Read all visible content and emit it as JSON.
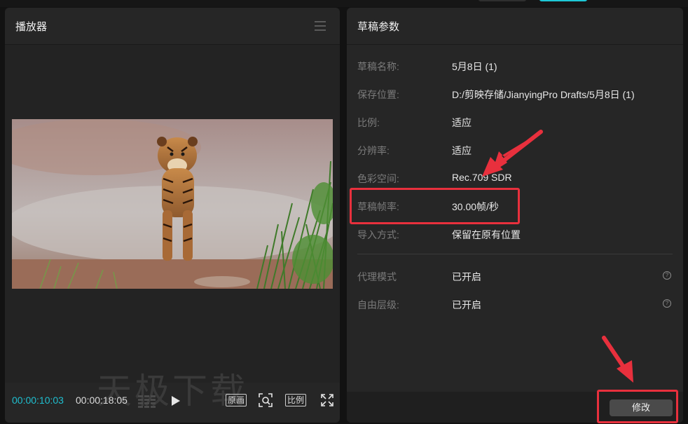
{
  "player": {
    "title": "播放器",
    "watermark": "天极下载",
    "time_current": "00:00:10:03",
    "time_total": "00:00:18:05",
    "btn_original": "原画",
    "btn_ratio": "比例"
  },
  "draft": {
    "title": "草稿参数",
    "rows": [
      {
        "label": "草稿名称:",
        "value": "5月8日 (1)"
      },
      {
        "label": "保存位置:",
        "value": "D:/剪映存储/JianyingPro Drafts/5月8日 (1)"
      },
      {
        "label": "比例:",
        "value": "适应"
      },
      {
        "label": "分辨率:",
        "value": "适应"
      },
      {
        "label": "色彩空间:",
        "value": "Rec.709 SDR"
      },
      {
        "label": "草稿帧率:",
        "value": "30.00帧/秒"
      },
      {
        "label": "导入方式:",
        "value": "保留在原有位置"
      },
      {
        "label": "代理模式",
        "value": "已开启"
      },
      {
        "label": "自由层级:",
        "value": "已开启"
      }
    ],
    "modify_label": "修改"
  },
  "colors": {
    "accent": "#1fbfd0",
    "annotation_red": "#e8303d"
  }
}
